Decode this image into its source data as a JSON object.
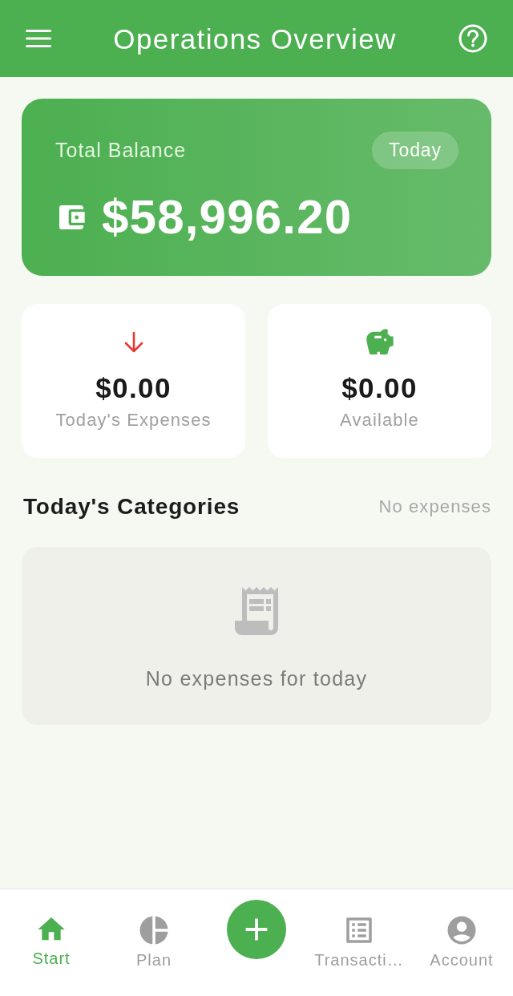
{
  "header": {
    "title": "Operations Overview"
  },
  "balance_card": {
    "label": "Total Balance",
    "badge": "Today",
    "amount": "$58,996.20"
  },
  "stats": [
    {
      "kind": "expenses",
      "amount": "$0.00",
      "label": "Today's Expenses"
    },
    {
      "kind": "available",
      "amount": "$0.00",
      "label": "Available"
    }
  ],
  "categories": {
    "title": "Today's Categories",
    "summary": "No expenses",
    "empty_message": "No expenses for today"
  },
  "bottom_nav": [
    {
      "kind": "home",
      "label": "Start",
      "selected": true
    },
    {
      "kind": "plan",
      "label": "Plan",
      "selected": false
    },
    {
      "kind": "add",
      "selected": false
    },
    {
      "kind": "transactions",
      "label": "Transacti…",
      "selected": false
    },
    {
      "kind": "account",
      "label": "Account",
      "selected": false
    }
  ]
}
